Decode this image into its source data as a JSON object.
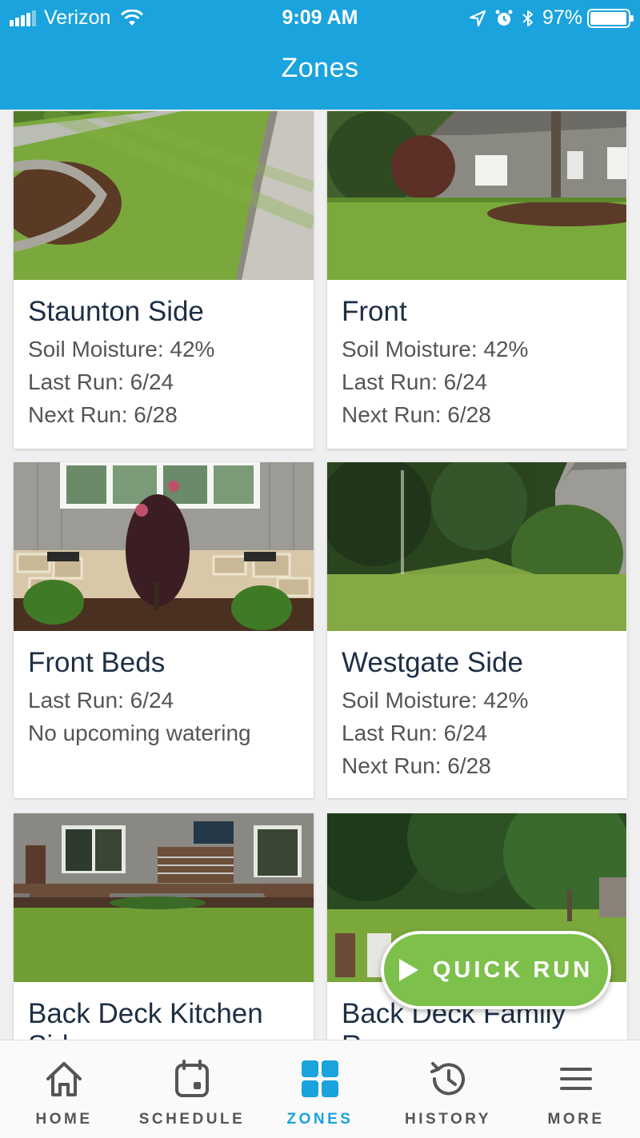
{
  "status_bar": {
    "carrier": "Verizon",
    "time": "9:09 AM",
    "battery": "97%",
    "battery_level": 0.97
  },
  "header": {
    "title": "Zones"
  },
  "zones": [
    {
      "name": "Staunton Side",
      "lines": [
        "Soil Moisture: 42%",
        "Last Run: 6/24",
        "Next Run: 6/28"
      ]
    },
    {
      "name": "Front",
      "lines": [
        "Soil Moisture: 42%",
        "Last Run: 6/24",
        "Next Run: 6/28"
      ]
    },
    {
      "name": "Front Beds",
      "lines": [
        "Last Run: 6/24",
        "No upcoming watering"
      ]
    },
    {
      "name": "Westgate Side",
      "lines": [
        "Soil Moisture: 42%",
        "Last Run: 6/24",
        "Next Run: 6/28"
      ]
    },
    {
      "name": "Back Deck Kitchen Side",
      "lines": []
    },
    {
      "name": "Back Deck Family Room",
      "lines": []
    }
  ],
  "quick_run": {
    "label": "QUICK RUN"
  },
  "tabs": [
    {
      "label": "HOME",
      "icon": "home-icon"
    },
    {
      "label": "SCHEDULE",
      "icon": "calendar-icon"
    },
    {
      "label": "ZONES",
      "icon": "grid-icon",
      "active": true
    },
    {
      "label": "HISTORY",
      "icon": "history-icon"
    },
    {
      "label": "MORE",
      "icon": "menu-icon"
    }
  ],
  "colors": {
    "accent": "#1aa3dd",
    "quick_run": "#7dc04b",
    "zone_title": "#1e2f44"
  }
}
